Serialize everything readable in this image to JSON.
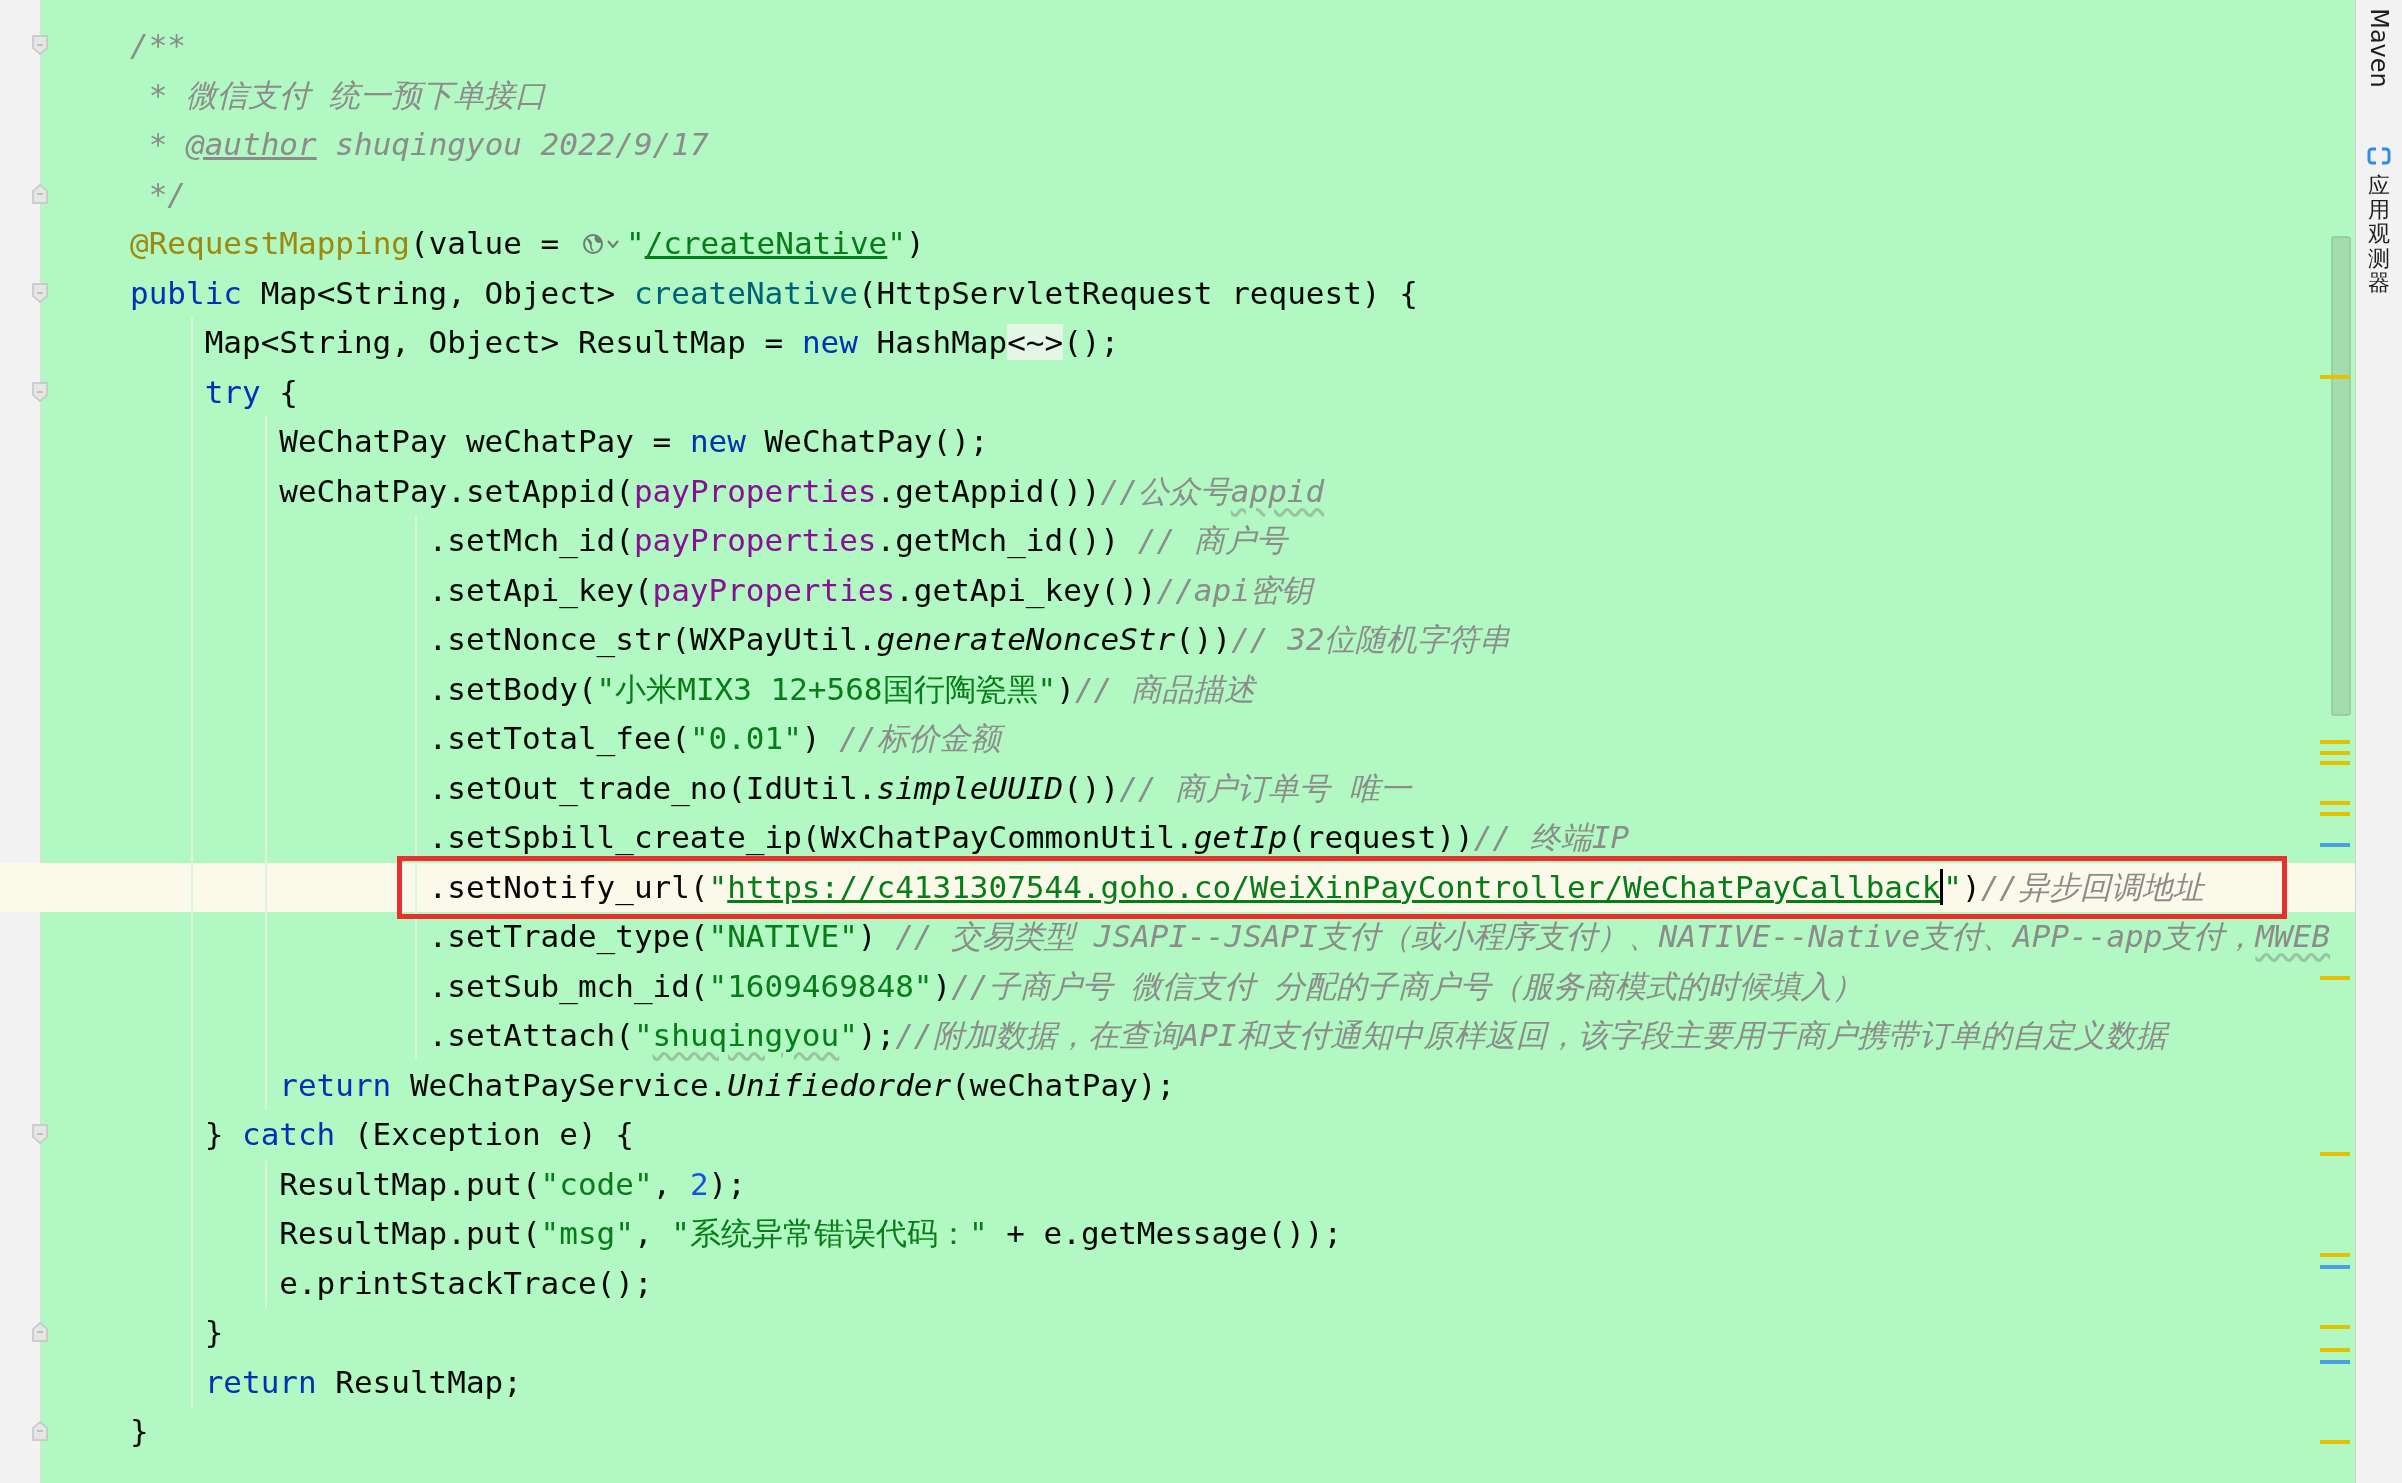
{
  "editor": {
    "lines": [
      {
        "fold_start": true,
        "tokens": [
          {
            "kind": "comment",
            "text": "/**"
          }
        ]
      },
      {
        "tokens": [
          {
            "kind": "comment",
            "text": " * 微信支付 统一预下单接口"
          }
        ]
      },
      {
        "tokens": [
          {
            "kind": "comment",
            "text": " * "
          },
          {
            "kind": "comment-tag",
            "text": "@author"
          },
          {
            "kind": "comment",
            "text": " shuqingyou 2022/9/17"
          }
        ]
      },
      {
        "fold_end": true,
        "tokens": [
          {
            "kind": "comment",
            "text": " */"
          }
        ]
      },
      {
        "tokens": [
          {
            "kind": "annotation",
            "text": "@RequestMapping"
          },
          {
            "kind": "plain",
            "text": "(value = "
          },
          {
            "kind": "globe-icon"
          },
          {
            "kind": "string",
            "text": "\""
          },
          {
            "kind": "url",
            "text": "/createNative"
          },
          {
            "kind": "string",
            "text": "\""
          },
          {
            "kind": "plain",
            "text": ")"
          }
        ]
      },
      {
        "fold_start": true,
        "tokens": [
          {
            "kind": "keyword",
            "text": "public"
          },
          {
            "kind": "plain",
            "text": " Map<String, Object> "
          },
          {
            "kind": "method-decl",
            "text": "createNative"
          },
          {
            "kind": "plain",
            "text": "(HttpServletRequest request) {"
          }
        ],
        "children": [
          {
            "tokens": [
              {
                "kind": "plain",
                "text": "Map<String, Object> ResultMap = "
              },
              {
                "kind": "keyword",
                "text": "new"
              },
              {
                "kind": "plain",
                "text": " HashMap"
              },
              {
                "kind": "diamond",
                "text": "<~>"
              },
              {
                "kind": "plain",
                "text": "();"
              }
            ]
          },
          {
            "fold_start": true,
            "tokens": [
              {
                "kind": "keyword",
                "text": "try"
              },
              {
                "kind": "plain",
                "text": " {"
              }
            ],
            "children": [
              {
                "tokens": [
                  {
                    "kind": "plain",
                    "text": "WeChatPay weChatPay = "
                  },
                  {
                    "kind": "keyword",
                    "text": "new"
                  },
                  {
                    "kind": "plain",
                    "text": " WeChatPay();"
                  }
                ]
              },
              {
                "kind": "chain",
                "tokens": [
                  {
                    "kind": "plain",
                    "text": "weChatPay.setAppid("
                  },
                  {
                    "kind": "field",
                    "text": "payProperties"
                  },
                  {
                    "kind": "plain",
                    "text": ".getAppid())"
                  },
                  {
                    "kind": "comment",
                    "text": "//公众号"
                  },
                  {
                    "kind": "comment-typo",
                    "text": "appid"
                  }
                ],
                "children": [
                  {
                    "tokens": [
                      {
                        "kind": "plain",
                        "text": ".setMch_id("
                      },
                      {
                        "kind": "field",
                        "text": "payProperties"
                      },
                      {
                        "kind": "plain",
                        "text": ".getMch_id()) "
                      },
                      {
                        "kind": "comment",
                        "text": "// 商户号"
                      }
                    ]
                  },
                  {
                    "tokens": [
                      {
                        "kind": "plain",
                        "text": ".setApi_key("
                      },
                      {
                        "kind": "field",
                        "text": "payProperties"
                      },
                      {
                        "kind": "plain",
                        "text": ".getApi_key())"
                      },
                      {
                        "kind": "comment",
                        "text": "//api密钥"
                      }
                    ]
                  },
                  {
                    "tokens": [
                      {
                        "kind": "plain",
                        "text": ".setNonce_str(WXPayUtil."
                      },
                      {
                        "kind": "static-call",
                        "text": "generateNonceStr"
                      },
                      {
                        "kind": "plain",
                        "text": "())"
                      },
                      {
                        "kind": "comment",
                        "text": "// 32位随机字符串"
                      }
                    ]
                  },
                  {
                    "tokens": [
                      {
                        "kind": "plain",
                        "text": ".setBody("
                      },
                      {
                        "kind": "string",
                        "text": "\"小米MIX3 12+568国行陶瓷黑\""
                      },
                      {
                        "kind": "plain",
                        "text": ")"
                      },
                      {
                        "kind": "comment",
                        "text": "// 商品描述"
                      }
                    ]
                  },
                  {
                    "tokens": [
                      {
                        "kind": "plain",
                        "text": ".setTotal_fee("
                      },
                      {
                        "kind": "string",
                        "text": "\"0.01\""
                      },
                      {
                        "kind": "plain",
                        "text": ") "
                      },
                      {
                        "kind": "comment",
                        "text": "//标价金额"
                      }
                    ]
                  },
                  {
                    "tokens": [
                      {
                        "kind": "plain",
                        "text": ".setOut_trade_no(IdUtil."
                      },
                      {
                        "kind": "static-call",
                        "text": "simpleUUID"
                      },
                      {
                        "kind": "plain",
                        "text": "())"
                      },
                      {
                        "kind": "comment",
                        "text": "// 商户订单号 唯一"
                      }
                    ]
                  },
                  {
                    "tokens": [
                      {
                        "kind": "plain",
                        "text": ".setSpbill_create_ip(WxChatPayCommonUtil."
                      },
                      {
                        "kind": "static-call",
                        "text": "getIp"
                      },
                      {
                        "kind": "plain",
                        "text": "(request))"
                      },
                      {
                        "kind": "comment",
                        "text": "// 终端IP"
                      }
                    ]
                  },
                  {
                    "current": true,
                    "boxed": true,
                    "tokens": [
                      {
                        "kind": "plain",
                        "text": ".setNotify_url("
                      },
                      {
                        "kind": "string",
                        "text": "\""
                      },
                      {
                        "kind": "url",
                        "text": "https://c4131307544.goho.co/WeiXinPayController/WeChatPayCallback"
                      },
                      {
                        "kind": "caret"
                      },
                      {
                        "kind": "string",
                        "text": "\""
                      },
                      {
                        "kind": "plain",
                        "text": ")"
                      },
                      {
                        "kind": "comment",
                        "text": "//异步回调地址"
                      }
                    ]
                  },
                  {
                    "tokens": [
                      {
                        "kind": "plain",
                        "text": ".setTrade_type("
                      },
                      {
                        "kind": "string",
                        "text": "\"NATIVE\""
                      },
                      {
                        "kind": "plain",
                        "text": ") "
                      },
                      {
                        "kind": "comment",
                        "text": "// 交易类型 JSAPI--JSAPI支付（或小程序支付）、NATIVE--Native支付、APP--app支付，"
                      },
                      {
                        "kind": "comment-typo",
                        "text": "MWEB"
                      }
                    ]
                  },
                  {
                    "tokens": [
                      {
                        "kind": "plain",
                        "text": ".setSub_mch_id("
                      },
                      {
                        "kind": "string",
                        "text": "\"1609469848\""
                      },
                      {
                        "kind": "plain",
                        "text": ")"
                      },
                      {
                        "kind": "comment",
                        "text": "//子商户号 微信支付 分配的子商户号（服务商模式的时候填入）"
                      }
                    ]
                  },
                  {
                    "tokens": [
                      {
                        "kind": "plain",
                        "text": ".setAttach("
                      },
                      {
                        "kind": "string",
                        "text": "\""
                      },
                      {
                        "kind": "string-typo",
                        "text": "shuqingyou"
                      },
                      {
                        "kind": "string",
                        "text": "\""
                      },
                      {
                        "kind": "plain",
                        "text": ");"
                      },
                      {
                        "kind": "comment",
                        "text": "//附加数据，在查询API和支付通知中原样返回，该字段主要用于商户携带订单的自定义数据"
                      }
                    ]
                  }
                ]
              },
              {
                "tokens": [
                  {
                    "kind": "keyword",
                    "text": "return"
                  },
                  {
                    "kind": "plain",
                    "text": " WeChatPayService."
                  },
                  {
                    "kind": "static-call",
                    "text": "Unifiedorder"
                  },
                  {
                    "kind": "plain",
                    "text": "(weChatPay);"
                  }
                ]
              }
            ]
          },
          {
            "fold_start": true,
            "tokens": [
              {
                "kind": "plain",
                "text": "} "
              },
              {
                "kind": "keyword",
                "text": "catch"
              },
              {
                "kind": "plain",
                "text": " (Exception e) {"
              }
            ],
            "children": [
              {
                "tokens": [
                  {
                    "kind": "plain",
                    "text": "ResultMap.put("
                  },
                  {
                    "kind": "string",
                    "text": "\"code\""
                  },
                  {
                    "kind": "plain",
                    "text": ", "
                  },
                  {
                    "kind": "number",
                    "text": "2"
                  },
                  {
                    "kind": "plain",
                    "text": ");"
                  }
                ]
              },
              {
                "tokens": [
                  {
                    "kind": "plain",
                    "text": "ResultMap.put("
                  },
                  {
                    "kind": "string",
                    "text": "\"msg\""
                  },
                  {
                    "kind": "plain",
                    "text": ", "
                  },
                  {
                    "kind": "string",
                    "text": "\"系统异常错误代码：\""
                  },
                  {
                    "kind": "plain",
                    "text": " + e.getMessage());"
                  }
                ]
              },
              {
                "tokens": [
                  {
                    "kind": "plain",
                    "text": "e.printStackTrace();"
                  }
                ]
              }
            ]
          },
          {
            "fold_end": true,
            "tokens": [
              {
                "kind": "plain",
                "text": "}"
              }
            ]
          },
          {
            "tokens": [
              {
                "kind": "keyword",
                "text": "return"
              },
              {
                "kind": "plain",
                "text": " ResultMap;"
              }
            ]
          }
        ]
      },
      {
        "fold_end": true,
        "tokens": [
          {
            "kind": "plain",
            "text": "}"
          }
        ]
      }
    ]
  },
  "side_panel": {
    "tabs": [
      {
        "kind": "rotated",
        "label": "Maven"
      },
      {
        "kind": "stacked",
        "label": "应用观测器"
      }
    ]
  }
}
